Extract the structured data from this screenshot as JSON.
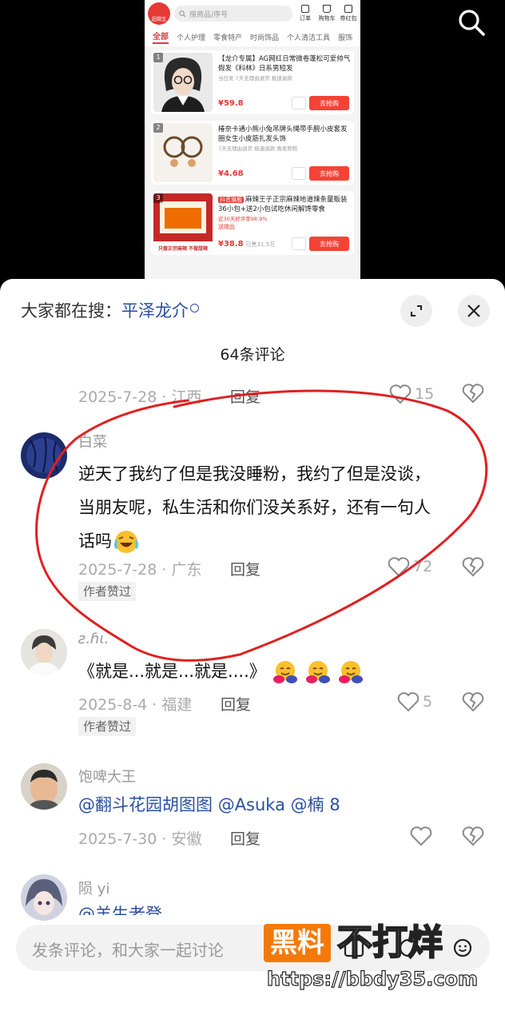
{
  "shop": {
    "search_placeholder": "搜商品/序号",
    "logo_text": "超精宝",
    "icons": [
      "订单",
      "购物车",
      "券红包"
    ],
    "tabs": [
      "全部",
      "个人护理",
      "零食特产",
      "时尚饰品",
      "个人清洁工具",
      "服饰"
    ],
    "products": [
      {
        "rank": "1",
        "tag": "",
        "title": "【龙介专属】AG网红日常微卷蓬松可爱帅气假发《科林》日系男短发",
        "meta": "当日发  7天无理由退货  极速退款",
        "sub": "",
        "price": "¥59.8",
        "sold": "",
        "button": "去抢购"
      },
      {
        "rank": "2",
        "tag": "",
        "title": "椿奈卡通小熊小兔吊牌头绳带手腕小皮套发圈女生小皮筋扎发头饰",
        "meta": "7天无理由退货  极速退款  晚发即赔",
        "sub": "",
        "price": "¥4.68",
        "sold": "",
        "button": "去抢购"
      },
      {
        "rank": "3",
        "tag": "抖音旗舰",
        "title": "麻辣王子正宗麻辣地道辣条量贩装36小包+送2小包试吃休闲解馋零食",
        "meta": "近30天好评率98.9%",
        "sub": "送赠品",
        "price": "¥38.8",
        "sold": "已售31.5万",
        "button": "去抢购"
      }
    ],
    "product3_banner": "只做正宗麻辣 不做甜辣"
  },
  "header": {
    "hot_prefix": "大家都在搜：",
    "hot_term": "平泽龙介",
    "comment_count": "64条评论"
  },
  "comments": [
    {
      "name": "",
      "text": "",
      "date_loc": "2025-7-28 · 江西",
      "reply": "回复",
      "likes": "15",
      "badge": ""
    },
    {
      "name": "白菜",
      "text_lines": [
        "逆天了我约了但是我没睡粉，我约了但是没谈，",
        "当朋友呢，私生活和你们没关系好，还有一句人",
        "话吗"
      ],
      "date_loc": "2025-7-28 · 广东",
      "reply": "回复",
      "likes": "72",
      "badge": "作者赞过"
    },
    {
      "name": "ƨ.ɦι.",
      "text": "《就是...就是...就是....》",
      "date_loc": "2025-8-4 · 福建",
      "reply": "回复",
      "likes": "5",
      "badge": "作者赞过"
    },
    {
      "name": "饱啤大王",
      "mentions": [
        "@翻斗花园胡图图",
        "@Asuka",
        "@楠 8"
      ],
      "date_loc": "2025-7-30 · 安徽",
      "reply": "回复",
      "likes": "",
      "badge": ""
    },
    {
      "name": "陨 yi",
      "text": "@羊生老登",
      "date_loc": "",
      "reply": "",
      "likes": "",
      "badge": ""
    }
  ],
  "input": {
    "placeholder": "发条评论，和大家一起讨论"
  },
  "watermark": {
    "box": "黑料",
    "text": "不打烊",
    "url": "https://bbdy35.com"
  },
  "colors": {
    "accent_red": "#e53935",
    "link_blue": "#2a4fa0",
    "annotation_red": "#e02020",
    "watermark_orange": "#f37a0a"
  }
}
